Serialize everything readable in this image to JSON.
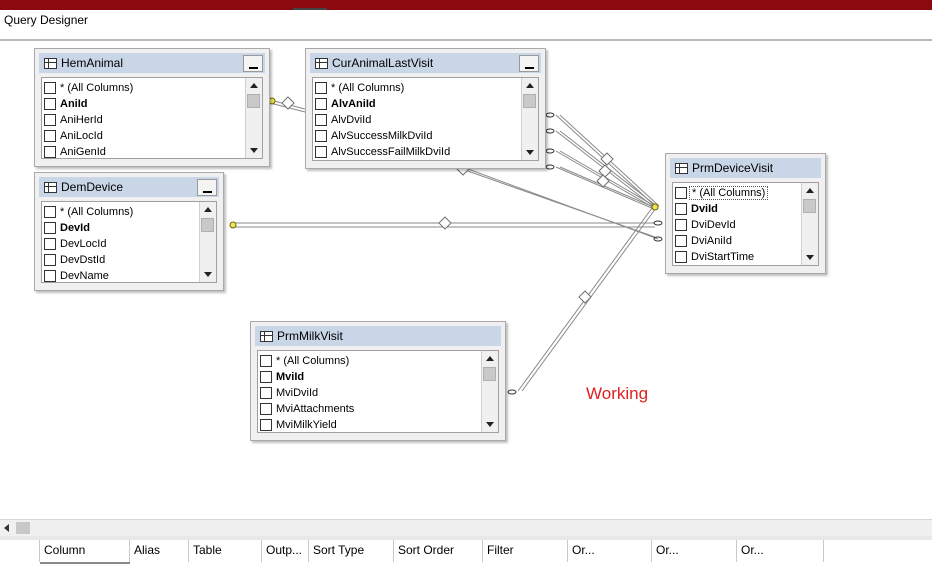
{
  "window": {
    "title": "Query Designer",
    "status_text": "Working"
  },
  "tables": {
    "hemanimal": {
      "title": "HemAnimal",
      "columns": [
        "* (All Columns)",
        "AniId",
        "AniHerId",
        "AniLocId",
        "AniGenId"
      ]
    },
    "curanimallastvisit": {
      "title": "CurAnimalLastVisit",
      "columns": [
        "* (All Columns)",
        "AlvAniId",
        "AlvDviId",
        "AlvSuccessMilkDviId",
        "AlvSuccessFailMilkDviId"
      ]
    },
    "demdevice": {
      "title": "DemDevice",
      "columns": [
        "* (All Columns)",
        "DevId",
        "DevLocId",
        "DevDstId",
        "DevName"
      ]
    },
    "prmdevicevisit": {
      "title": "PrmDeviceVisit",
      "columns": [
        "* (All Columns)",
        "DviId",
        "DviDevId",
        "DviAniId",
        "DviStartTime"
      ]
    },
    "prmmilkvisit": {
      "title": "PrmMilkVisit",
      "columns": [
        "* (All Columns)",
        "MviId",
        "MviDviId",
        "MviAttachments",
        "MviMilkYield"
      ]
    }
  },
  "grid": {
    "headers": [
      "Column",
      "Alias",
      "Table",
      "Outp...",
      "Sort Type",
      "Sort Order",
      "Filter",
      "Or...",
      "Or...",
      "Or..."
    ]
  }
}
